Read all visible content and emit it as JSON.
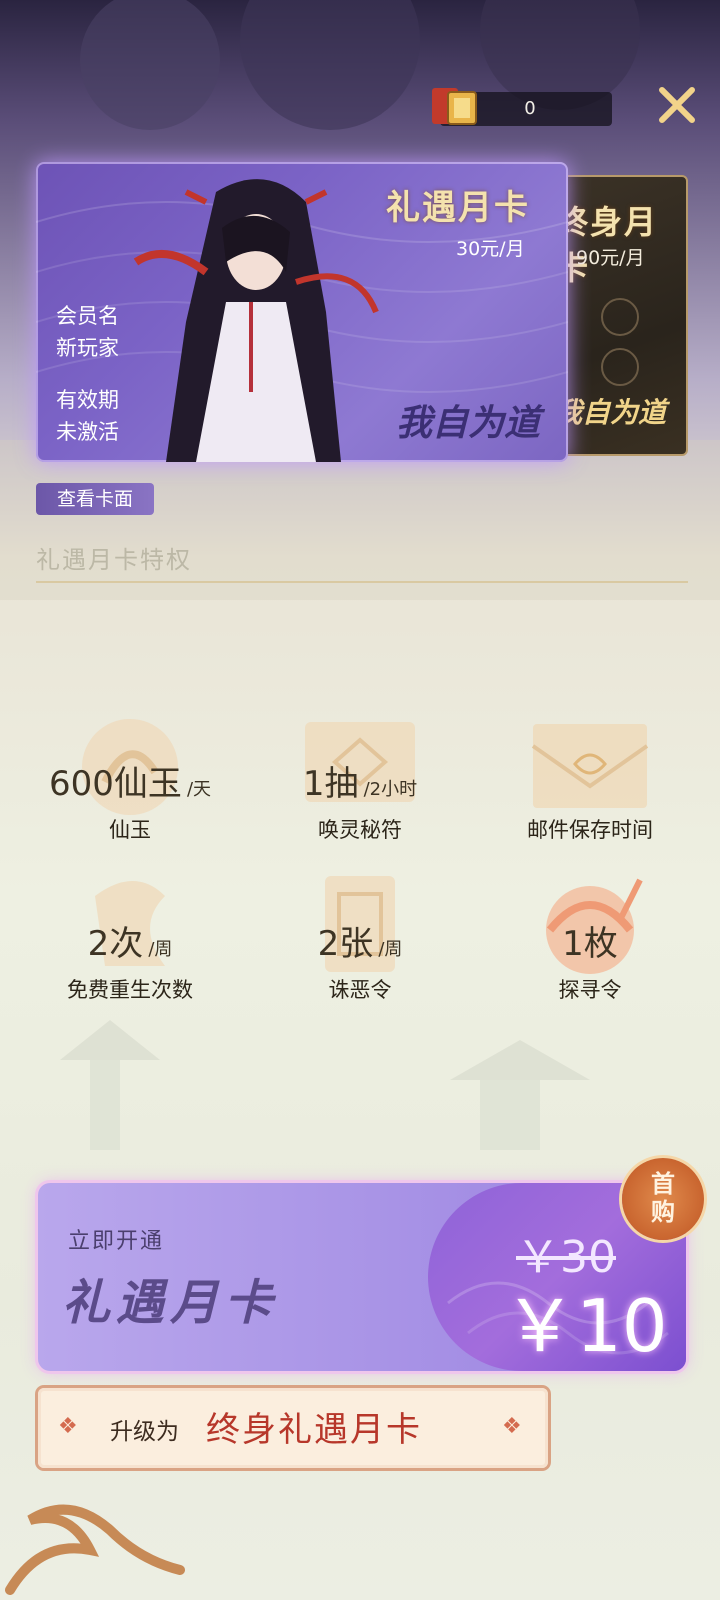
{
  "top_bar": {
    "currency_value": "0"
  },
  "cards": {
    "main": {
      "title": "礼遇月卡",
      "price": "30元/月",
      "member_label": "会员名",
      "member_value": "新玩家",
      "validity_label": "有效期",
      "validity_value": "未激活",
      "logo_text": "我自为道"
    },
    "secondary": {
      "title": "终身月卡",
      "price": "90元/月",
      "logo_text": "我自为道"
    }
  },
  "view_card_label": "查看卡面",
  "section_title": "礼遇月卡特权",
  "privileges": [
    {
      "value": "600仙玉",
      "unit": "/天",
      "name": "仙玉"
    },
    {
      "value": "1抽",
      "unit": "/2小时",
      "name": "唤灵秘符"
    },
    {
      "value": "",
      "unit": "",
      "name": "邮件保存时间"
    },
    {
      "value": "2次",
      "unit": "/周",
      "name": "免费重生次数"
    },
    {
      "value": "2张",
      "unit": "/周",
      "name": "诛恶令"
    },
    {
      "value": "1枚",
      "unit": "",
      "name": "探寻令"
    }
  ],
  "purchase": {
    "subtitle": "立即开通",
    "title": "礼遇月卡",
    "old_price": "￥30",
    "new_price": "￥10",
    "badge": [
      "首",
      "购"
    ]
  },
  "upgrade": {
    "prefix": "升级为",
    "highlight": "终身礼遇月卡"
  },
  "colors": {
    "accent_purple": "#8a74c4",
    "gold": "#f4e2ae",
    "red": "#b7372a"
  }
}
